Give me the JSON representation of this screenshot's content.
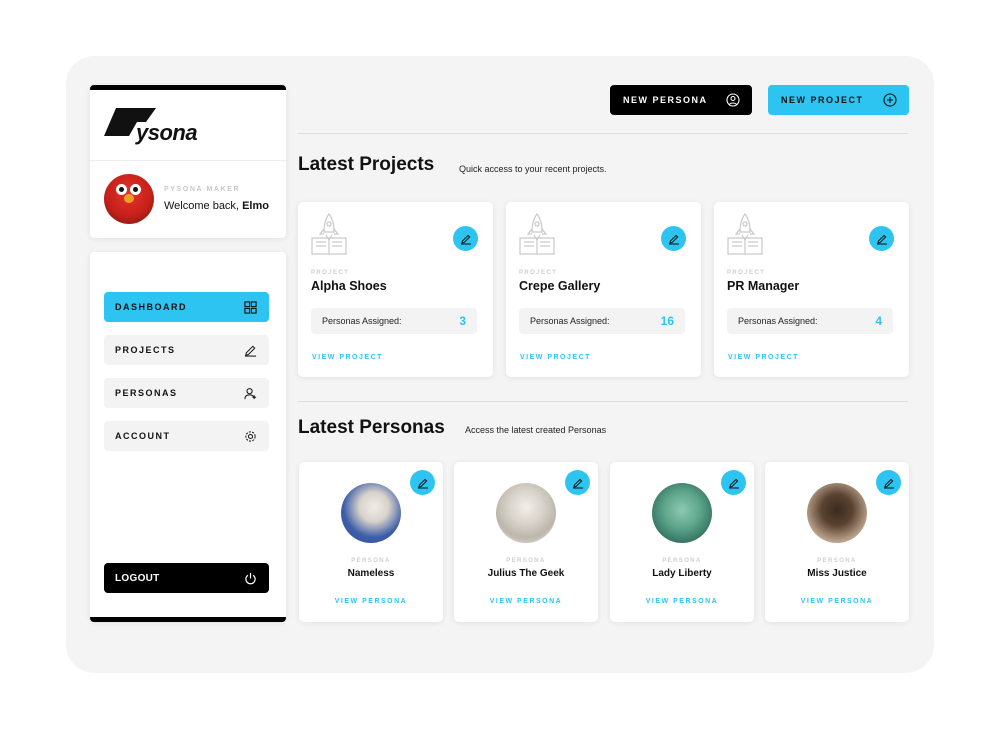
{
  "brand": {
    "logo_text": "ysona"
  },
  "user": {
    "role_label": "PYSONA MAKER",
    "welcome_prefix": "Welcome back, ",
    "name": "Elmo"
  },
  "sidebar": {
    "items": [
      {
        "label": "DASHBOARD",
        "icon": "grid-icon"
      },
      {
        "label": "PROJECTS",
        "icon": "pencil-icon"
      },
      {
        "label": "PERSONAS",
        "icon": "user-plus-icon"
      },
      {
        "label": "ACCOUNT",
        "icon": "gear-icon"
      }
    ],
    "logout_label": "LOGOUT"
  },
  "header": {
    "new_persona_label": "NEW PERSONA",
    "new_project_label": "NEW PROJECT"
  },
  "projects_section": {
    "title": "Latest Projects",
    "subtitle": "Quick access to your recent projects.",
    "cards": [
      {
        "tag": "PROJECT",
        "name": "Alpha Shoes",
        "assigned_label": "Personas Assigned:",
        "assigned_count": "3",
        "link": "VIEW PROJECT"
      },
      {
        "tag": "PROJECT",
        "name": "Crepe Gallery",
        "assigned_label": "Personas Assigned:",
        "assigned_count": "16",
        "link": "VIEW PROJECT"
      },
      {
        "tag": "PROJECT",
        "name": "PR Manager",
        "assigned_label": "Personas Assigned:",
        "assigned_count": "4",
        "link": "VIEW PROJECT"
      }
    ]
  },
  "personas_section": {
    "title": "Latest Personas",
    "subtitle": "Access the latest created Personas",
    "cards": [
      {
        "tag": "PERSONA",
        "name": "Nameless",
        "link": "VIEW PERSONA"
      },
      {
        "tag": "PERSONA",
        "name": "Julius The Geek",
        "link": "VIEW PERSONA"
      },
      {
        "tag": "PERSONA",
        "name": "Lady Liberty",
        "link": "VIEW PERSONA"
      },
      {
        "tag": "PERSONA",
        "name": "Miss Justice",
        "link": "VIEW PERSONA"
      }
    ]
  },
  "colors": {
    "accent": "#2ec4f1",
    "dark": "#000000",
    "background": "#f4f4f4"
  }
}
